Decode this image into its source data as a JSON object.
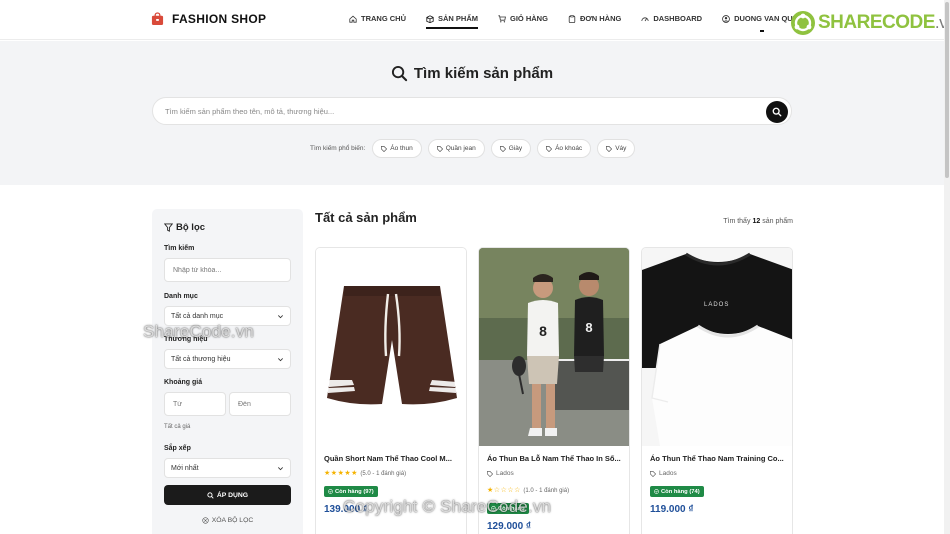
{
  "brand": {
    "name": "FASHION SHOP",
    "icon": "shopping-bag-icon"
  },
  "nav": {
    "items": [
      {
        "label": "TRANG CHỦ",
        "icon": "home-icon"
      },
      {
        "label": "SẢN PHẨM",
        "icon": "box-icon",
        "active": true
      },
      {
        "label": "GIỎ HÀNG",
        "icon": "cart-icon"
      },
      {
        "label": "ĐƠN HÀNG",
        "icon": "clipboard-icon"
      },
      {
        "label": "DASHBOARD",
        "icon": "gauge-icon"
      },
      {
        "label": "DUONG VAN QUY",
        "icon": "user-icon"
      }
    ]
  },
  "logo": {
    "name": "SHARECODE",
    "suffix": ".vn",
    "color": "#8fc23f"
  },
  "hero": {
    "title": "Tìm kiếm sản phẩm",
    "search_placeholder": "Tìm kiếm sản phẩm theo tên, mô tả, thương hiệu...",
    "popular_label": "Tìm kiếm phổ biến:",
    "popular_tags": [
      "Áo thun",
      "Quần jean",
      "Giày",
      "Áo khoác",
      "Váy"
    ]
  },
  "filter": {
    "title": "Bộ lọc",
    "keyword_label": "Tìm kiếm",
    "keyword_placeholder": "Nhập từ khóa...",
    "category_label": "Danh mục",
    "category_value": "Tất cả danh mục",
    "brand_label": "Thương hiệu",
    "brand_value": "Tất cả thương hiệu",
    "price_label": "Khoảng giá",
    "price_from_placeholder": "Từ",
    "price_to_placeholder": "Đến",
    "price_hint": "Tất cả giá",
    "sort_label": "Sắp xếp",
    "sort_value": "Mới nhất",
    "apply_label": "ÁP DỤNG",
    "clear_label": "XÓA BỘ LỌC"
  },
  "content": {
    "title": "Tất cả sản phẩm",
    "count_prefix": "Tìm thấy",
    "count": "12",
    "count_suffix": "sản phẩm"
  },
  "products": [
    {
      "name": "Quần Short Nam Thể Thao Cool M...",
      "rating": 5,
      "rating_text": "(5.0 - 1 đánh giá)",
      "stock": "Còn hàng (97)",
      "price": "139.000 ₫"
    },
    {
      "name": "Áo Thun Ba Lỗ Nam Thể Thao In Số...",
      "brand": "Lados",
      "rating": 1,
      "rating_text": "(1.0 - 1 đánh giá)",
      "stock": "Còn hàng",
      "price": "129.000 ₫"
    },
    {
      "name": "Áo Thun Thể Thao Nam Training Co...",
      "brand": "Lados",
      "stock": "Còn hàng (74)",
      "price": "119.000 ₫"
    }
  ],
  "watermarks": {
    "left": "ShareCode.vn",
    "bottom": "Copyright © ShareCode.vn"
  },
  "colors": {
    "accent": "#111111",
    "price": "#1f4f99",
    "stock": "#1f8a46",
    "star": "#f5b301"
  }
}
